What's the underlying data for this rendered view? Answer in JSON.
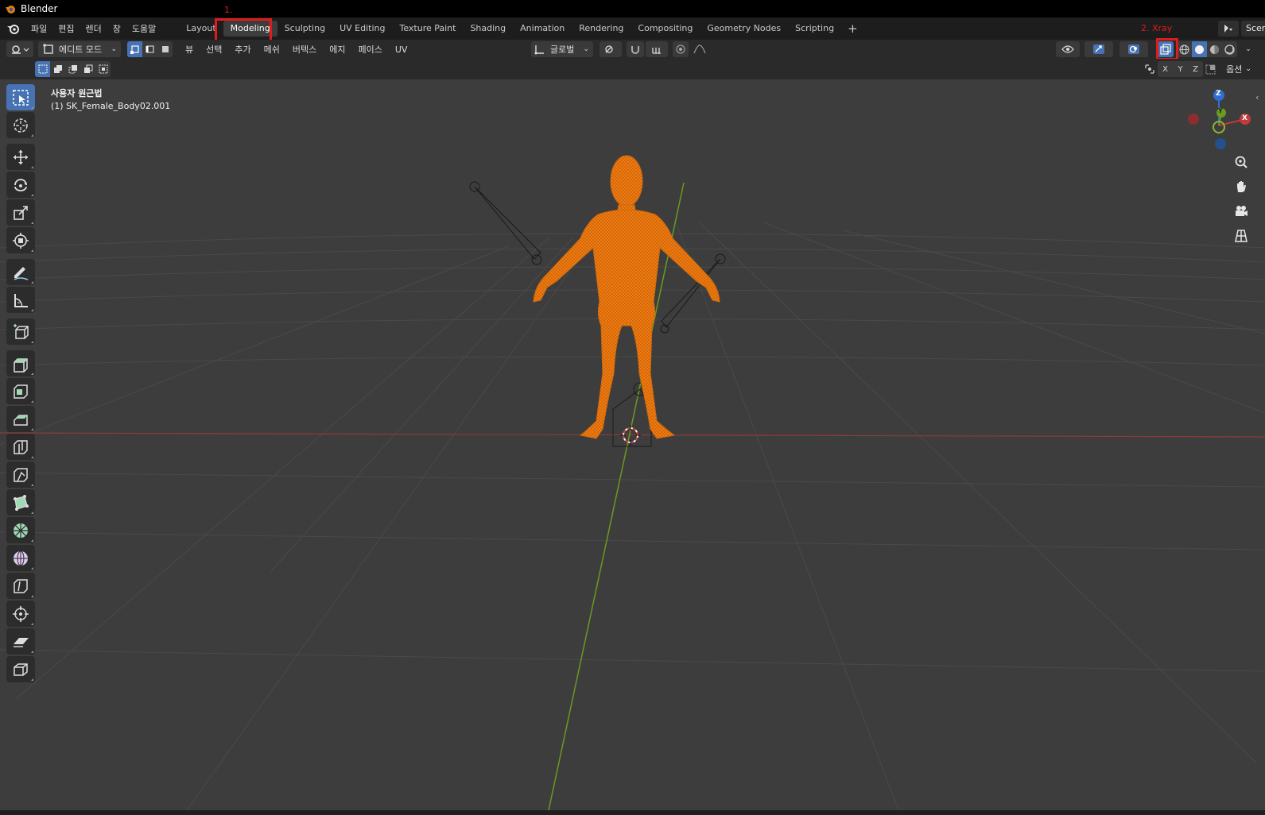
{
  "window": {
    "title": "Blender"
  },
  "menu": [
    "파일",
    "편집",
    "렌더",
    "창",
    "도움말"
  ],
  "workspace_tabs": [
    "Layout",
    "Modeling",
    "Sculpting",
    "UV Editing",
    "Texture Paint",
    "Shading",
    "Animation",
    "Rendering",
    "Compositing",
    "Geometry Nodes",
    "Scripting"
  ],
  "active_tab": "Modeling",
  "tab_add": "+",
  "scene": {
    "label": "Scene"
  },
  "annotations": {
    "step1": "1.",
    "step2": "2. Xray"
  },
  "header": {
    "mode": "에디트 모드",
    "menus": [
      "뷰",
      "선택",
      "추가",
      "메쉬",
      "버텍스",
      "에지",
      "페이스",
      "UV"
    ],
    "orientation": "글로벌",
    "axes": [
      "X",
      "Y",
      "Z"
    ],
    "options": "옵션"
  },
  "viewport": {
    "view_name": "사용자 원근법",
    "object_name": "(1) SK_Female_Body02.001"
  },
  "gizmo": {
    "z": "Z",
    "y": "Y",
    "x": "X"
  },
  "colors": {
    "mesh": "#f07a10",
    "accent": "#4772b3",
    "annotation": "#e01b1b",
    "x_axis": "#c0393b",
    "y_axis": "#6a9a1e"
  }
}
